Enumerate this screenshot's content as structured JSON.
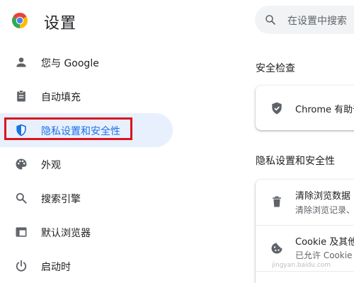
{
  "header": {
    "title": "设置",
    "search_placeholder": "在设置中搜索"
  },
  "sidebar": {
    "items": [
      {
        "label": "您与 Google",
        "icon": "person-icon"
      },
      {
        "label": "自动填充",
        "icon": "clipboard-icon"
      },
      {
        "label": "隐私设置和安全性",
        "icon": "shield-icon",
        "active": true
      },
      {
        "label": "外观",
        "icon": "palette-icon"
      },
      {
        "label": "搜索引擎",
        "icon": "search-icon"
      },
      {
        "label": "默认浏览器",
        "icon": "browser-window-icon"
      },
      {
        "label": "启动时",
        "icon": "power-icon"
      }
    ]
  },
  "main": {
    "safety_check": {
      "title": "安全检查",
      "row_text": "Chrome 有助于"
    },
    "privacy": {
      "title": "隐私设置和安全性",
      "rows": [
        {
          "title": "清除浏览数据",
          "subtitle": "清除浏览记录、",
          "icon": "trash-icon"
        },
        {
          "title": "Cookie 及其他",
          "subtitle": "已允许 Cookie",
          "icon": "cookie-icon"
        }
      ]
    }
  },
  "watermark": "jingyan.baidu.com",
  "colors": {
    "accent": "#1a73e8",
    "active_bg": "#e8f0fe",
    "highlight_box": "#d9141f",
    "text": "#202124",
    "icon": "#5f6368"
  }
}
